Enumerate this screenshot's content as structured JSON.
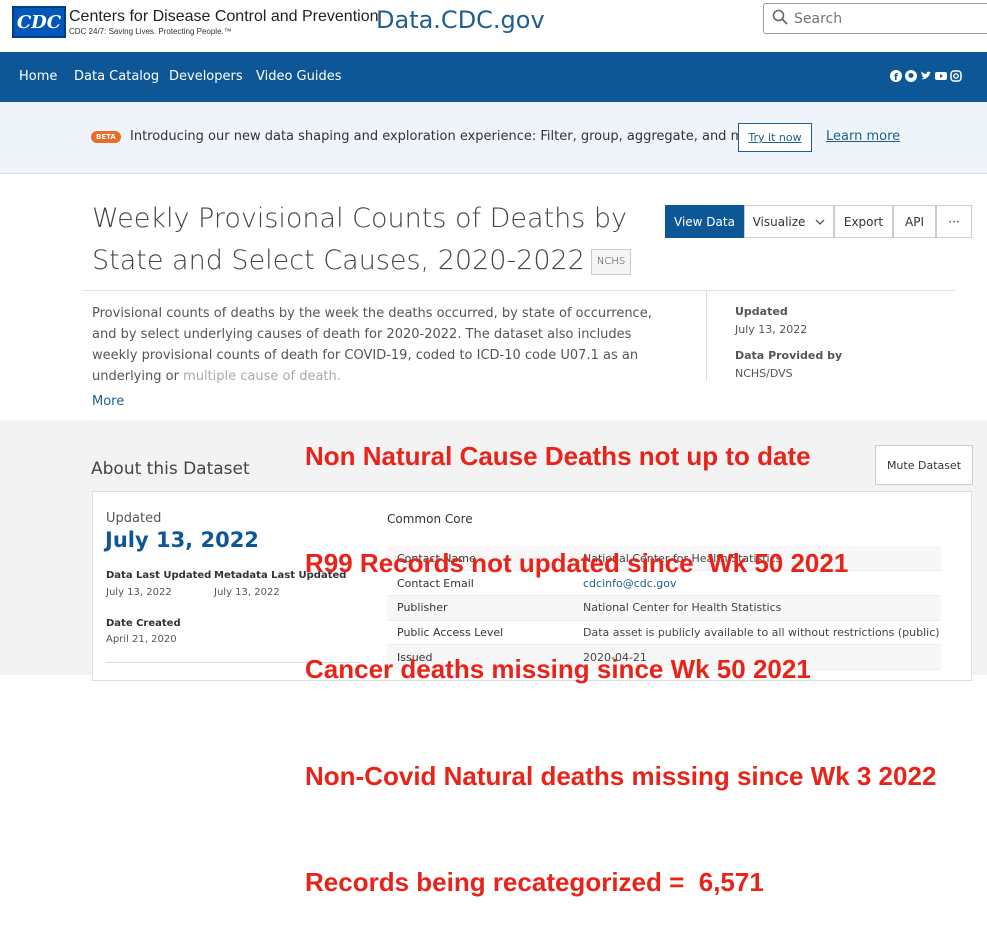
{
  "header": {
    "logo": "CDC",
    "org_name": "Centers for Disease Control and Prevention",
    "tagline": "CDC 24/7: Saving Lives. Protecting People.™",
    "site_name": "Data.CDC.gov",
    "search_placeholder": "Search"
  },
  "nav": {
    "items": [
      "Home",
      "Data Catalog",
      "Developers",
      "Video Guides"
    ],
    "social_icons": [
      "facebook-icon",
      "github-icon",
      "twitter-icon",
      "youtube-icon",
      "instagram-icon"
    ]
  },
  "banner": {
    "badge": "BETA",
    "text": "Introducing our new data shaping and exploration experience: Filter, group, aggregate, and more!",
    "try_label": "Try it now",
    "learn_label": "Learn more"
  },
  "dataset": {
    "title": "Weekly Provisional Counts of Deaths by State and Select Causes, 2020-2022",
    "agency_badge": "NCHS",
    "actions": [
      "View Data",
      "Visualize",
      "Export",
      "API",
      "···"
    ],
    "description": "Provisional counts of deaths by the week the deaths occurred, by state of occurrence, and by select underlying causes of death for 2020-2022. The dataset also includes weekly provisional counts of death for COVID-19, coded to ICD-10 code U07.1 as an underlying or",
    "description_faded": "multiple cause of death.",
    "more_label": "More",
    "updated_label": "Updated",
    "updated_value": "July 13, 2022",
    "provided_label": "Data Provided by",
    "provided_value": "NCHS/DVS"
  },
  "about": {
    "heading": "About this Dataset",
    "mute_label": "Mute Dataset",
    "updated_label": "Updated",
    "updated_value": "July 13, 2022",
    "data_last_updated_label": "Data Last Updated",
    "data_last_updated_value": "July 13, 2022",
    "metadata_last_updated_label": "Metadata Last Updated",
    "metadata_last_updated_value": "July 13, 2022",
    "date_created_label": "Date Created",
    "date_created_value": "April 21, 2020",
    "section_title": "Common Core",
    "rows": [
      {
        "key": "Contact Name",
        "value": "National Center for Health Statistics"
      },
      {
        "key": "Contact Email",
        "value": "cdcinfo@cdc.gov"
      },
      {
        "key": "Publisher",
        "value": "National Center for Health Statistics"
      },
      {
        "key": "Public Access Level",
        "value": "Data asset is publicly available to all without restrictions (public)"
      },
      {
        "key": "Issued",
        "value": "2020-04-21"
      }
    ]
  },
  "overlay": {
    "lines": [
      "Non Natural Cause Deaths not up to date",
      "R99 Records not updated since  Wk 50 2021",
      "Cancer deaths missing since Wk 50 2021",
      "Non-Covid Natural deaths missing since Wk 3 2022",
      "Records being recategorized =  6,571"
    ],
    "color": "#e8241a"
  }
}
